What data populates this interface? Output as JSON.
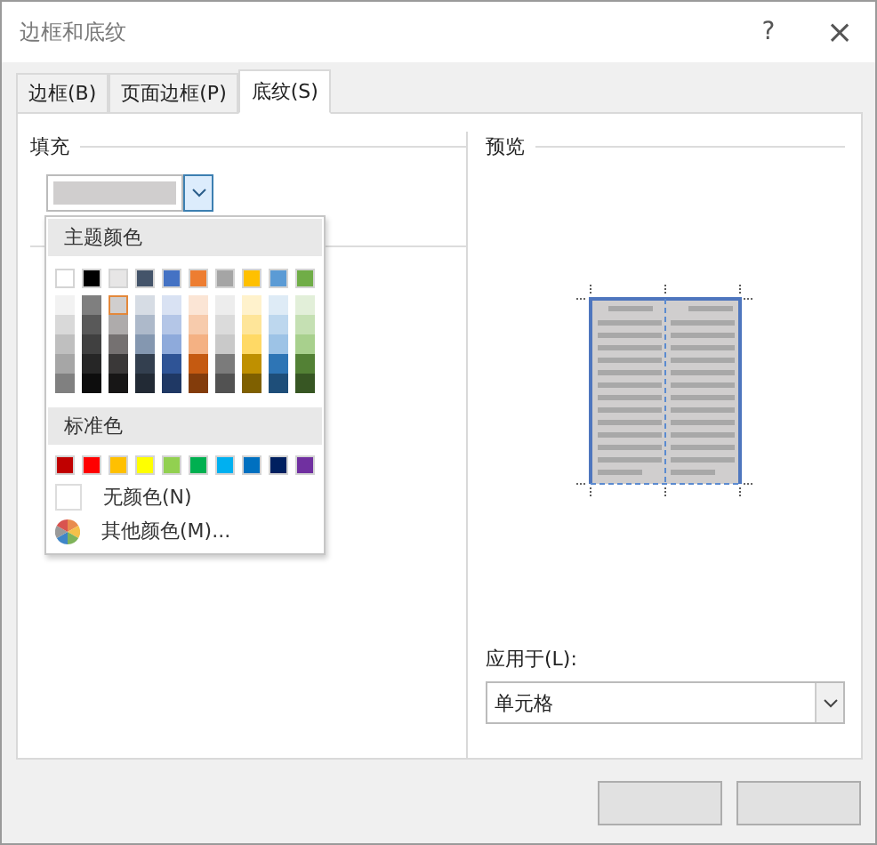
{
  "window": {
    "title": "边框和底纹",
    "help": "?",
    "close": "×"
  },
  "tabs": [
    {
      "label": "边框(B)",
      "selected": false
    },
    {
      "label": "页面边框(P)",
      "selected": false
    },
    {
      "label": "底纹(S)",
      "selected": true
    }
  ],
  "fill": {
    "heading": "填充",
    "color": "#d0cece",
    "expanded": true
  },
  "color_menu": {
    "theme_heading": "主题颜色",
    "theme_columns": [
      {
        "color": "#ffffff",
        "selected": false,
        "shades": [
          {
            "color": "#f2f2f2",
            "selected": false
          },
          {
            "color": "#d9d9d9",
            "selected": false
          },
          {
            "color": "#bfbfbf",
            "selected": false
          },
          {
            "color": "#a6a6a6",
            "selected": false
          },
          {
            "color": "#808080",
            "selected": false
          }
        ]
      },
      {
        "color": "#000000",
        "selected": false,
        "shades": [
          {
            "color": "#7f7f7f",
            "selected": false
          },
          {
            "color": "#595959",
            "selected": false
          },
          {
            "color": "#404040",
            "selected": false
          },
          {
            "color": "#262626",
            "selected": false
          },
          {
            "color": "#0d0d0d",
            "selected": false
          }
        ]
      },
      {
        "color": "#e7e6e6",
        "selected": false,
        "shades": [
          {
            "color": "#d0cece",
            "selected": true
          },
          {
            "color": "#aeabab",
            "selected": false
          },
          {
            "color": "#757171",
            "selected": false
          },
          {
            "color": "#3a3838",
            "selected": false
          },
          {
            "color": "#171616",
            "selected": false
          }
        ]
      },
      {
        "color": "#44546a",
        "selected": false,
        "shades": [
          {
            "color": "#d6dce4",
            "selected": false
          },
          {
            "color": "#adb9ca",
            "selected": false
          },
          {
            "color": "#8497b0",
            "selected": false
          },
          {
            "color": "#333f4f",
            "selected": false
          },
          {
            "color": "#222a35",
            "selected": false
          }
        ]
      },
      {
        "color": "#4472c4",
        "selected": false,
        "shades": [
          {
            "color": "#d9e2f3",
            "selected": false
          },
          {
            "color": "#b4c6e7",
            "selected": false
          },
          {
            "color": "#8eaadb",
            "selected": false
          },
          {
            "color": "#2f5496",
            "selected": false
          },
          {
            "color": "#1f3864",
            "selected": false
          }
        ]
      },
      {
        "color": "#ed7d31",
        "selected": false,
        "shades": [
          {
            "color": "#fbe5d5",
            "selected": false
          },
          {
            "color": "#f7cbac",
            "selected": false
          },
          {
            "color": "#f4b183",
            "selected": false
          },
          {
            "color": "#c55a11",
            "selected": false
          },
          {
            "color": "#833c0b",
            "selected": false
          }
        ]
      },
      {
        "color": "#a5a5a5",
        "selected": false,
        "shades": [
          {
            "color": "#ededed",
            "selected": false
          },
          {
            "color": "#dbdbdb",
            "selected": false
          },
          {
            "color": "#c9c9c9",
            "selected": false
          },
          {
            "color": "#7b7b7b",
            "selected": false
          },
          {
            "color": "#525252",
            "selected": false
          }
        ]
      },
      {
        "color": "#ffc000",
        "selected": false,
        "shades": [
          {
            "color": "#fff2cc",
            "selected": false
          },
          {
            "color": "#fee599",
            "selected": false
          },
          {
            "color": "#ffd965",
            "selected": false
          },
          {
            "color": "#bf9000",
            "selected": false
          },
          {
            "color": "#7f6000",
            "selected": false
          }
        ]
      },
      {
        "color": "#5b9bd5",
        "selected": false,
        "shades": [
          {
            "color": "#deebf6",
            "selected": false
          },
          {
            "color": "#bdd7ee",
            "selected": false
          },
          {
            "color": "#9dc3e6",
            "selected": false
          },
          {
            "color": "#2e75b5",
            "selected": false
          },
          {
            "color": "#1e4e79",
            "selected": false
          }
        ]
      },
      {
        "color": "#70ad47",
        "selected": false,
        "shades": [
          {
            "color": "#e2efd9",
            "selected": false
          },
          {
            "color": "#c5e0b3",
            "selected": false
          },
          {
            "color": "#a8d08d",
            "selected": false
          },
          {
            "color": "#538135",
            "selected": false
          },
          {
            "color": "#375623",
            "selected": false
          }
        ]
      }
    ],
    "standard_heading": "标准色",
    "standard_colors": [
      {
        "color": "#c00000",
        "selected": false
      },
      {
        "color": "#ff0000",
        "selected": false
      },
      {
        "color": "#ffc000",
        "selected": false
      },
      {
        "color": "#ffff00",
        "selected": false
      },
      {
        "color": "#92d050",
        "selected": false
      },
      {
        "color": "#00b050",
        "selected": false
      },
      {
        "color": "#00b0f0",
        "selected": false
      },
      {
        "color": "#0070c0",
        "selected": false
      },
      {
        "color": "#002060",
        "selected": false
      },
      {
        "color": "#7030a0",
        "selected": false
      }
    ],
    "no_color": "无颜色(N)",
    "more_colors": "其他颜色(M)..."
  },
  "preview": {
    "heading": "预览"
  },
  "apply_to": {
    "label": "应用于(L):",
    "value": "单元格"
  }
}
